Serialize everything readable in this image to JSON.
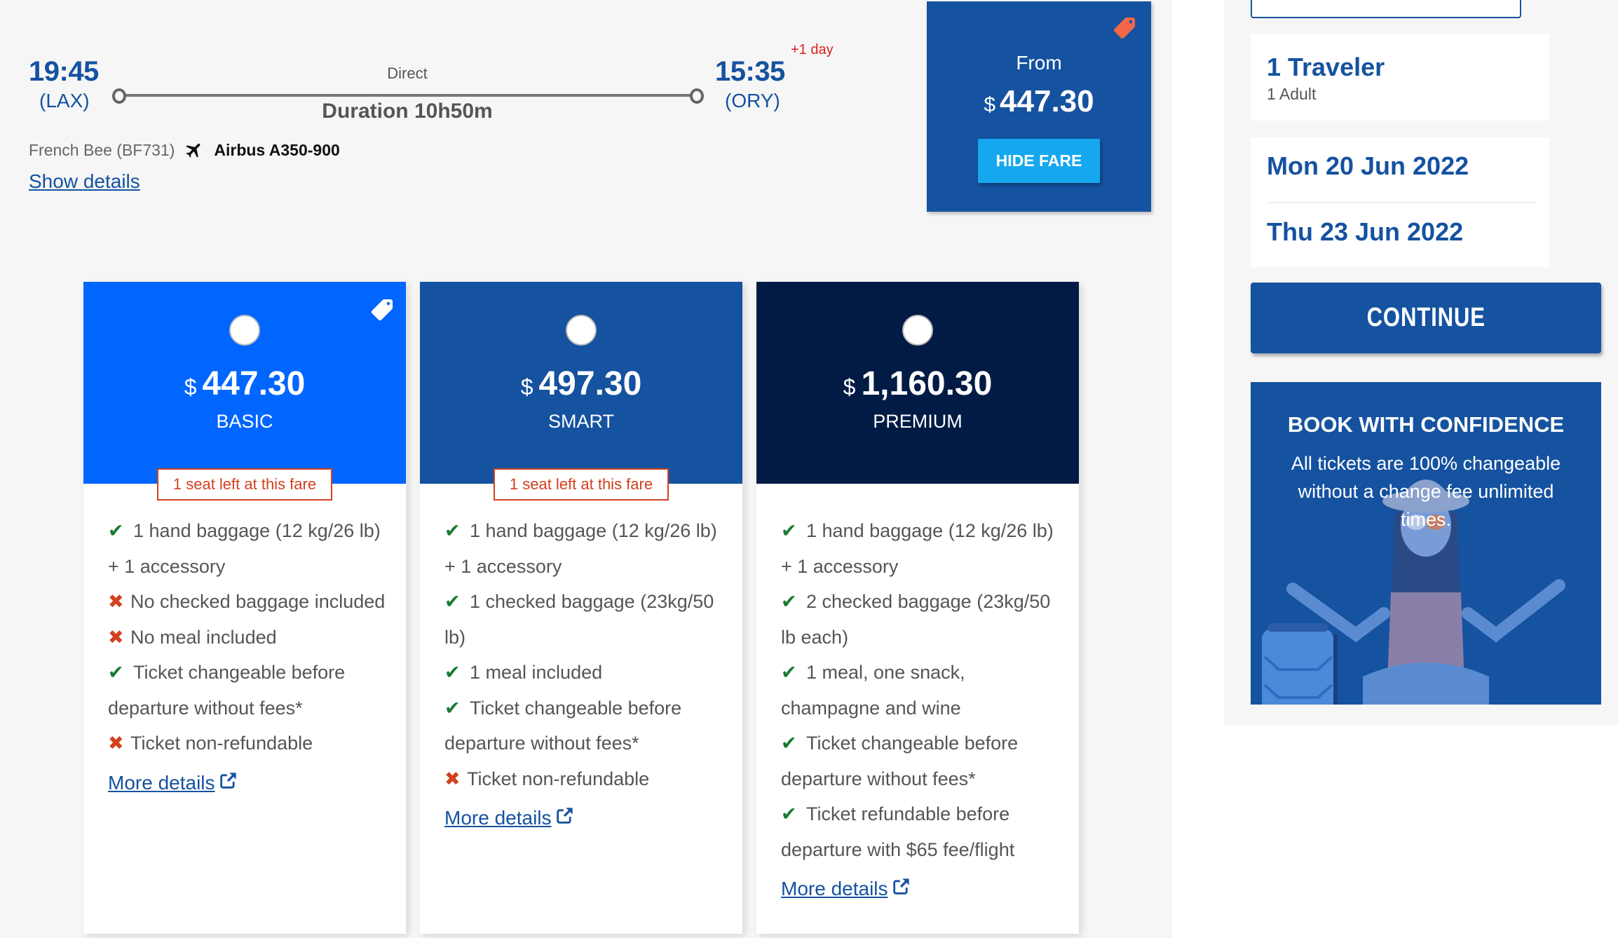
{
  "flight": {
    "departure_time": "19:45",
    "departure_code": "(LAX)",
    "arrival_time": "15:35",
    "arrival_code": "(ORY)",
    "day_offset": "+1 day",
    "stops": "Direct",
    "duration": "Duration 10h50m",
    "airline": "French Bee (BF731)",
    "aircraft": "Airbus A350-900",
    "aircraft_icon": "plane-icon",
    "show_details_label": "Show details"
  },
  "from_box": {
    "label": "From",
    "currency": "$",
    "price": "447.30",
    "tag_icon": "tag-icon",
    "hide_fare_label": "HIDE FARE"
  },
  "fares": [
    {
      "name": "BASIC",
      "currency": "$",
      "price": "447.30",
      "selected": false,
      "has_tag": true,
      "seats_left": "1 seat left at this fare",
      "header_color": "#0066ff",
      "features": [
        {
          "included": true,
          "text": "1 hand baggage (12 kg/26 lb) + 1 accessory"
        },
        {
          "included": false,
          "text": "No checked baggage included"
        },
        {
          "included": false,
          "text": "No meal included"
        },
        {
          "included": true,
          "text": "Ticket changeable before departure without fees*"
        },
        {
          "included": false,
          "text": "Ticket non-refundable"
        }
      ],
      "more_details_label": "More details"
    },
    {
      "name": "SMART",
      "currency": "$",
      "price": "497.30",
      "selected": false,
      "has_tag": false,
      "seats_left": "1 seat left at this fare",
      "header_color": "#1552a0",
      "features": [
        {
          "included": true,
          "text": "1 hand baggage (12 kg/26 lb) + 1 accessory"
        },
        {
          "included": true,
          "text": "1 checked baggage (23kg/50 lb)"
        },
        {
          "included": true,
          "text": "1 meal included"
        },
        {
          "included": true,
          "text": "Ticket changeable before departure without fees*"
        },
        {
          "included": false,
          "text": "Ticket non-refundable"
        }
      ],
      "more_details_label": "More details"
    },
    {
      "name": "PREMIUM",
      "currency": "$",
      "price": "1,160.30",
      "selected": false,
      "has_tag": false,
      "seats_left": "",
      "header_color": "#021b45",
      "features": [
        {
          "included": true,
          "text": "1 hand baggage (12 kg/26 lb) + 1 accessory"
        },
        {
          "included": true,
          "text": "2 checked baggage (23kg/50 lb each)"
        },
        {
          "included": true,
          "text": "1 meal, one snack, champagne and wine"
        },
        {
          "included": true,
          "text": "Ticket changeable before departure without fees*"
        },
        {
          "included": true,
          "text": "Ticket refundable before departure with $65 fee/flight"
        }
      ],
      "more_details_label": "More details"
    }
  ],
  "sidebar": {
    "travelers_title": "1 Traveler",
    "travelers_detail": "1 Adult",
    "departure_date": "Mon 20 Jun 2022",
    "return_date": "Thu 23 Jun 2022",
    "continue_label": "CONTINUE",
    "confidence_title": "BOOK WITH CONFIDENCE",
    "confidence_text": "All tickets are 100% changeable without a change fee unlimited times."
  },
  "colors": {
    "brand_blue": "#1552a0",
    "basic_blue": "#0066ff",
    "premium_navy": "#021b45",
    "hide_fare_blue": "#16a8ee",
    "alert_red": "#d2401e",
    "check_green": "#1a7a32",
    "tag_orange": "#f2674a"
  }
}
